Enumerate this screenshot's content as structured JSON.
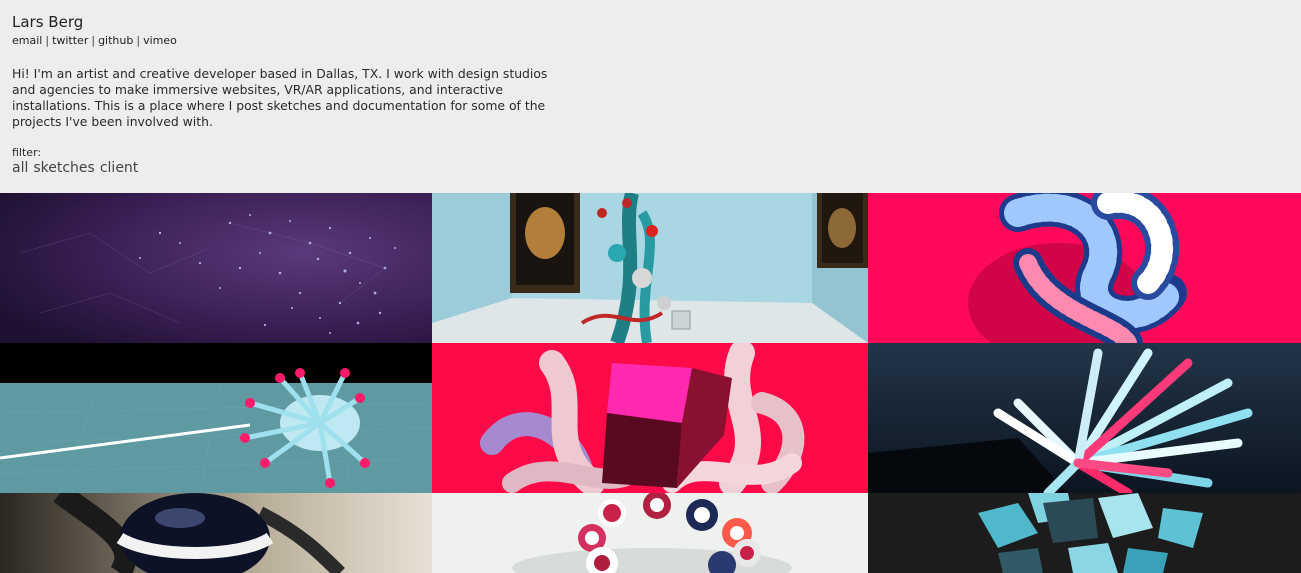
{
  "header": {
    "name": "Lars Berg",
    "links": [
      {
        "label": "email"
      },
      {
        "label": "twitter"
      },
      {
        "label": "github"
      },
      {
        "label": "vimeo"
      }
    ],
    "separator": "|",
    "intro": "Hi! I'm an artist and creative developer based in Dallas, TX. I work with design studios and agencies to make immersive websites, VR/AR applications, and interactive installations. This is a place where I post sketches and documentation for some of the projects I've been involved with.",
    "filter_label": "filter:",
    "filters": [
      {
        "label": "all"
      },
      {
        "label": "sketches"
      },
      {
        "label": "client"
      }
    ]
  },
  "colors": {
    "background": "#ededed",
    "hot_pink": "#ff0a5a",
    "cyan": "#3cc8d8",
    "gallery_blue": "#a9d6e3"
  },
  "tiles": [
    {
      "icon": "particle-galaxy-thumbnail"
    },
    {
      "icon": "gallery-sculpture-thumbnail"
    },
    {
      "icon": "striped-tubes-thumbnail"
    },
    {
      "icon": "tentacle-creature-thumbnail"
    },
    {
      "icon": "pink-cube-tubes-thumbnail"
    },
    {
      "icon": "radiating-rods-thumbnail"
    },
    {
      "icon": "dark-sphere-thumbnail"
    },
    {
      "icon": "beaded-ring-thumbnail"
    },
    {
      "icon": "cyan-blocks-thumbnail"
    }
  ]
}
